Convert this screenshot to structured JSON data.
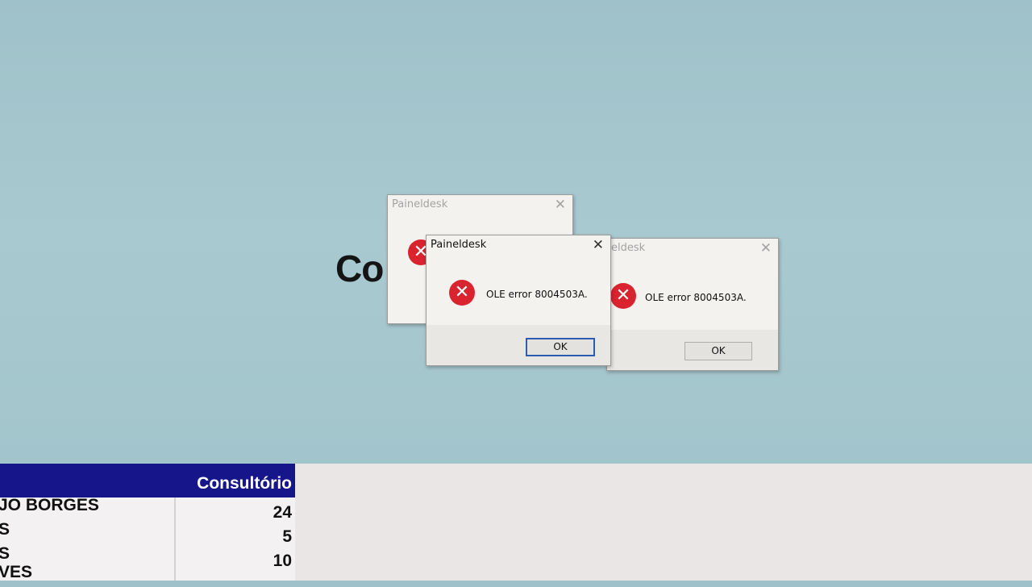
{
  "background": {
    "heading_fragment": "Co"
  },
  "dialogs": {
    "back": {
      "title": "Paineldesk",
      "close": "✕"
    },
    "front": {
      "title": "Paineldesk",
      "close": "✕",
      "icon": "error-x-icon",
      "message": "OLE error 8004503A.",
      "ok_label": "OK"
    },
    "right": {
      "title": "eldesk",
      "close": "✕",
      "icon": "error-x-icon",
      "message": "OLE error 8004503A.",
      "ok_label": "OK"
    }
  },
  "table": {
    "header": "Consultório",
    "rows": [
      {
        "name": "JO BORGES",
        "value": "24"
      },
      {
        "name": "S",
        "value": "5"
      },
      {
        "name": "S",
        "value": "10"
      },
      {
        "name": "VES",
        "value": ""
      }
    ]
  },
  "colors": {
    "header_bg": "#16168a",
    "error_red": "#d9232e",
    "desktop_bg": "#a3c5cc"
  }
}
